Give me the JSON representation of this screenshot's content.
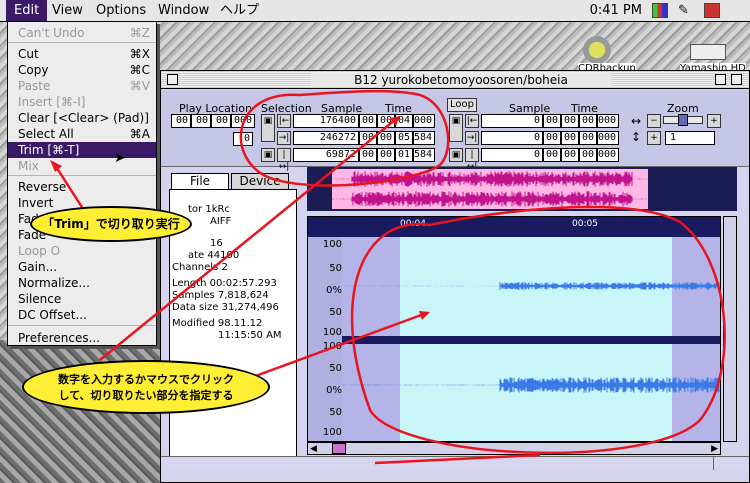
{
  "menubar": {
    "items": [
      "Edit",
      "View",
      "Options",
      "Window",
      "ヘルプ"
    ],
    "clock": "0:41 PM"
  },
  "edit_menu": {
    "items": [
      {
        "label": "Can't Undo",
        "shortcut": "⌘Z",
        "enabled": false
      },
      {
        "label": "Cut",
        "shortcut": "⌘X",
        "enabled": true
      },
      {
        "label": "Copy",
        "shortcut": "⌘C",
        "enabled": true
      },
      {
        "label": "Paste",
        "shortcut": "⌘V",
        "enabled": false
      },
      {
        "label": "Insert [⌘-I]",
        "shortcut": "",
        "enabled": false
      },
      {
        "label": "Clear [<Clear> (Pad)]",
        "shortcut": "",
        "enabled": true
      },
      {
        "label": "Select All",
        "shortcut": "⌘A",
        "enabled": true
      },
      {
        "label": "Trim [⌘-T]",
        "shortcut": "",
        "enabled": true,
        "highlighted": true
      },
      {
        "label": "Mix",
        "shortcut": "",
        "enabled": false
      },
      {
        "label": "Reverse",
        "shortcut": "",
        "enabled": true
      },
      {
        "label": "Invert",
        "shortcut": "",
        "enabled": true
      },
      {
        "label": "Fade",
        "shortcut": "",
        "enabled": true
      },
      {
        "label": "Fade",
        "shortcut": "",
        "enabled": true
      },
      {
        "label": "Loop O",
        "shortcut": "",
        "enabled": false
      },
      {
        "label": "Gain...",
        "shortcut": "",
        "enabled": true
      },
      {
        "label": "Normalize...",
        "shortcut": "",
        "enabled": true
      },
      {
        "label": "Silence",
        "shortcut": "",
        "enabled": true
      },
      {
        "label": "DC Offset...",
        "shortcut": "",
        "enabled": true
      },
      {
        "label": "Preferences...",
        "shortcut": "",
        "enabled": true
      }
    ]
  },
  "desktop_icons": {
    "icon1": "CDRbackup",
    "icon2": "Yamashin HD"
  },
  "window": {
    "title": "B12 yurokobetomoyoosoren/boheia",
    "play_location": {
      "label": "Play Location",
      "fields": [
        "00",
        "00",
        "00",
        "000"
      ],
      "field2": "0"
    },
    "selection": {
      "label": "Selection",
      "sample_label": "Sample",
      "time_label": "Time",
      "rows": [
        {
          "sample": "176400",
          "time": [
            "00",
            "00",
            "04",
            "000"
          ]
        },
        {
          "sample": "246272",
          "time": [
            "00",
            "00",
            "05",
            "584"
          ]
        },
        {
          "sample": "69872",
          "time": [
            "00",
            "00",
            "01",
            "584"
          ]
        }
      ]
    },
    "loop": {
      "label": "Loop",
      "sample_label": "Sample",
      "time_label": "Time",
      "rows": [
        {
          "sample": "0",
          "time": [
            "00",
            "00",
            "00",
            "000"
          ]
        },
        {
          "sample": "0",
          "time": [
            "00",
            "00",
            "00",
            "000"
          ]
        },
        {
          "sample": "0",
          "time": [
            "00",
            "00",
            "00",
            "000"
          ]
        }
      ]
    },
    "zoom": {
      "label": "Zoom",
      "value": "1"
    },
    "tabs": [
      "File",
      "Device"
    ],
    "info": [
      "tor  1kRc",
      "AIFF",
      "16",
      "ate  44100",
      "Channels  2",
      "Length  00:02:57.293",
      "Samples  7,818,624",
      "Data size  31,274,496",
      "Modified  98.11.12",
      "11:15:50 AM"
    ],
    "ruler": [
      "00:04",
      "00:05"
    ],
    "axis_top": [
      "100",
      "50",
      "0%",
      "50",
      "100"
    ],
    "axis_bottom": [
      "100",
      "50",
      "0%",
      "50",
      "100"
    ]
  },
  "annotations": {
    "trim_callout": "「Trim」で切り取り実行",
    "select_callout_line1": "数字を入力するかマウスでクリック",
    "select_callout_line2": "して、切り取りたい部分を指定する"
  },
  "colors": {
    "menu_highlight": "#3a1a66",
    "selection_overview": "#ffb8e6",
    "selection_wave": "#c8f6f8",
    "wave": "#3a7ae8",
    "annotation_red": "#e8141e",
    "callout_fill": "#ffee33"
  }
}
